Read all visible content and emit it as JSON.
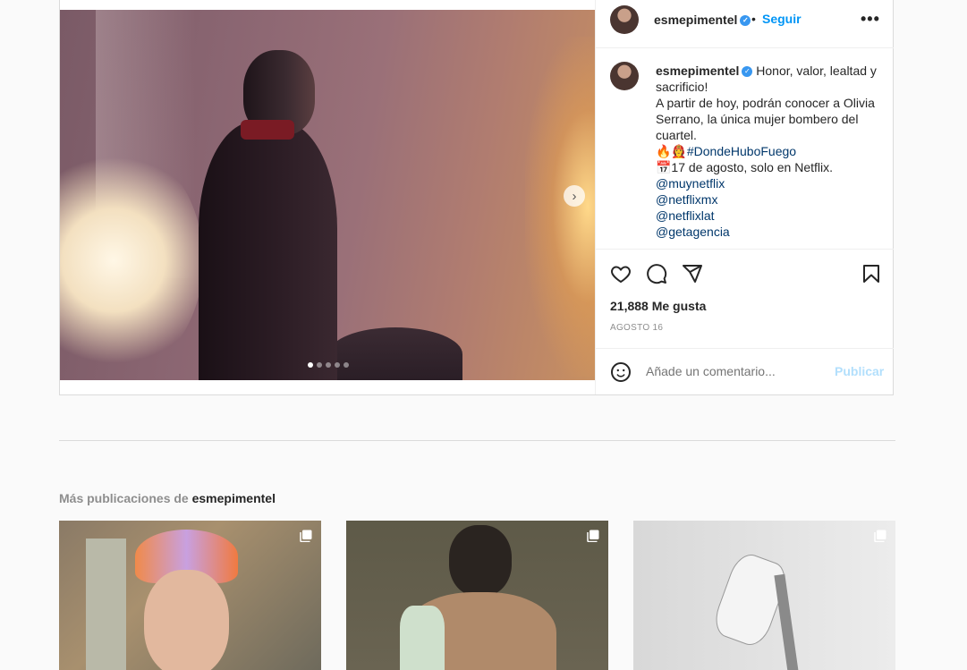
{
  "post": {
    "username": "esmepimentel",
    "follow_label": "Seguir",
    "separator": "•",
    "caption_lines": [
      "Honor, valor, lealtad y sacrificio!",
      "A partir de hoy, podrán conocer a Olivia Serrano, la única mujer bombero del cuartel.",
      "🔥👩‍🚒#DondeHuboFuego",
      "📅17 de agosto, solo en Netflix."
    ],
    "mentions": [
      "@muynetflix",
      "@netflixmx",
      "@netflixlat",
      "@getagencia"
    ],
    "likes": "21,888 Me gusta",
    "date": "AGOSTO 16",
    "comment_placeholder": "Añade un comentario...",
    "publish_label": "Publicar",
    "carousel": {
      "slides": 5,
      "active": 1
    }
  },
  "more_posts": {
    "prefix": "Más publicaciones de ",
    "username": "esmepimentel"
  },
  "colors": {
    "accent": "#0095f6",
    "verified": "#3897f0",
    "link": "#00376b",
    "publish_disabled": "#b2dffc"
  },
  "icons": [
    "chevron-right-icon",
    "verified-icon",
    "more-options-icon",
    "heart-icon",
    "comment-icon",
    "share-icon",
    "bookmark-icon",
    "emoji-icon",
    "multi-photo-icon"
  ]
}
